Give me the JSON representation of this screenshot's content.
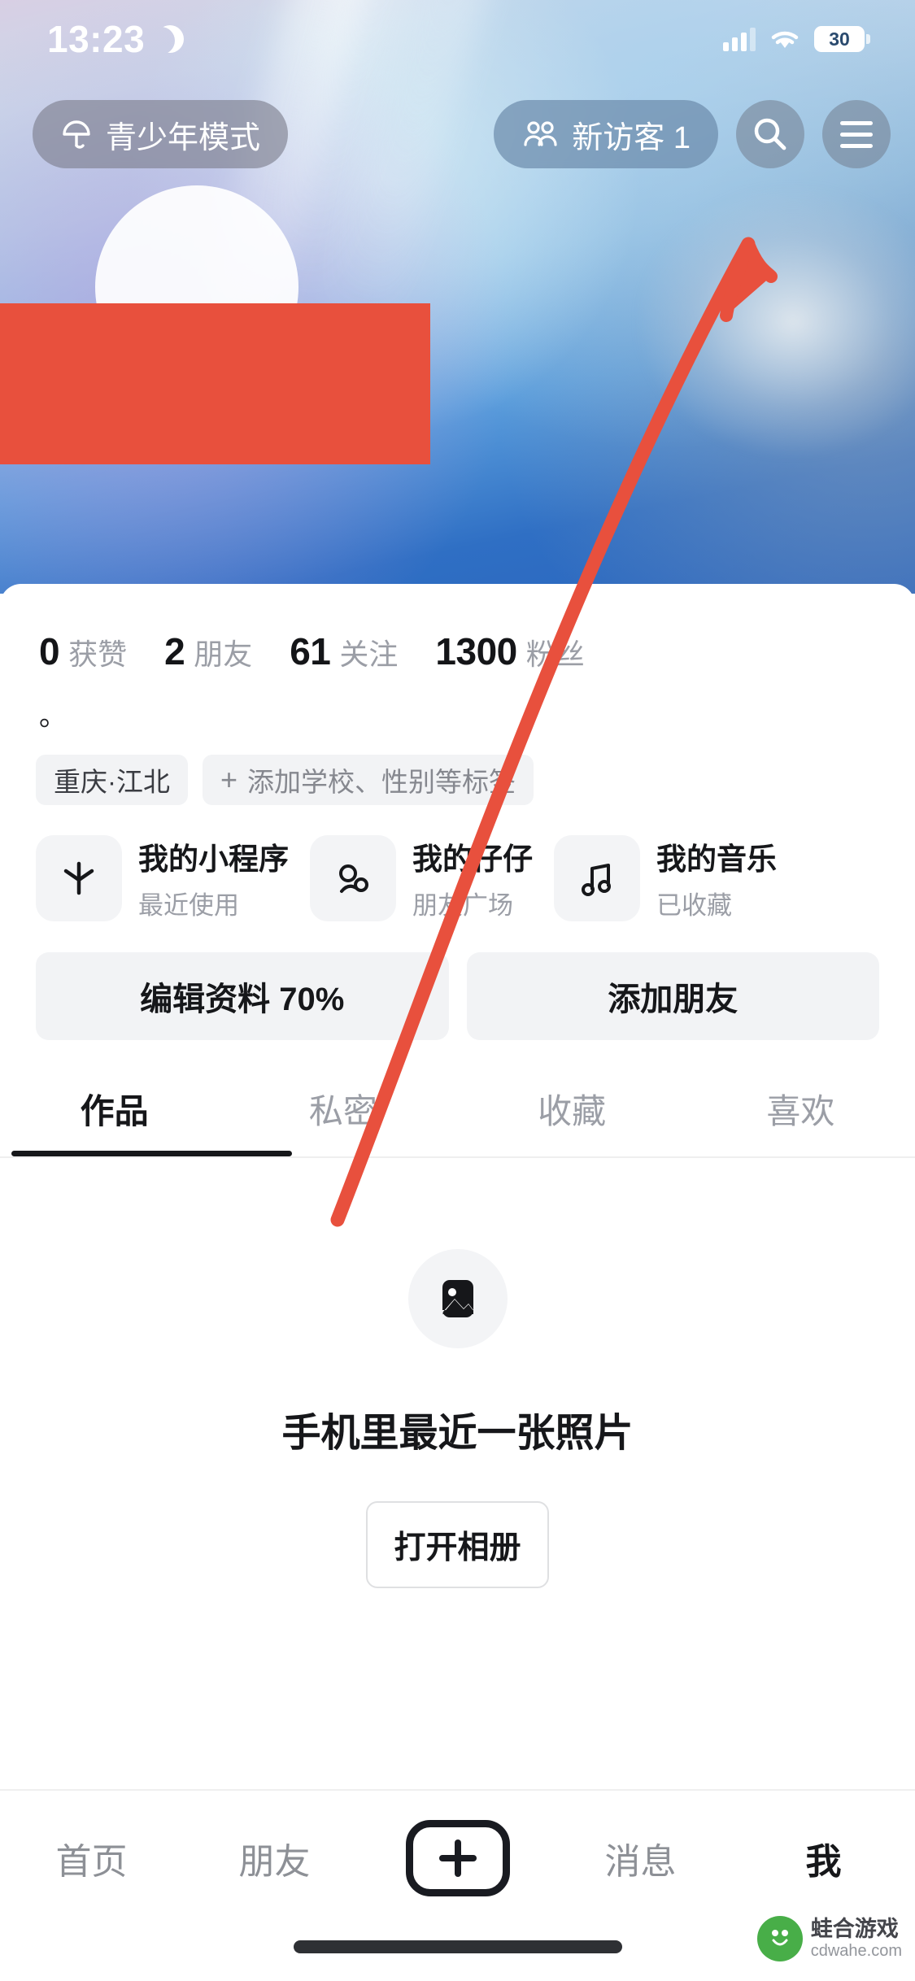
{
  "status_bar": {
    "time": "13:23",
    "moon_icon": "moon-icon",
    "signal_icon": "signal-bars-icon",
    "wifi_icon": "wifi-icon",
    "battery_level": "30"
  },
  "header": {
    "teen_mode_label": "青少年模式",
    "teen_mode_icon": "umbrella-icon",
    "visitor_label": "新访客 1",
    "visitor_icon": "people-icon",
    "search_icon": "search-icon",
    "menu_icon": "hamburger-menu-icon"
  },
  "annotation": {
    "arrow_color": "#e8503d",
    "redaction_color": "#e8503d"
  },
  "profile": {
    "stats": [
      {
        "num": "0",
        "label": "获赞"
      },
      {
        "num": "2",
        "label": "朋友"
      },
      {
        "num": "61",
        "label": "关注"
      },
      {
        "num": "1300",
        "label": "粉丝"
      }
    ],
    "bio": "。",
    "tags": [
      {
        "text": "重庆·江北",
        "type": "location"
      },
      {
        "text": "添加学校、性别等标签",
        "type": "add",
        "plus": "+"
      }
    ],
    "mini_cards": [
      {
        "title": "我的小程序",
        "sub": "最近使用",
        "icon": "asterisk-icon"
      },
      {
        "title": "我的仔仔",
        "sub": "朋友广场",
        "icon": "character-icon"
      },
      {
        "title": "我的音乐",
        "sub": "已收藏",
        "icon": "music-note-icon"
      }
    ],
    "actions": [
      {
        "label": "编辑资料 70%"
      },
      {
        "label": "添加朋友"
      }
    ]
  },
  "tabs": [
    {
      "label": "作品",
      "active": true
    },
    {
      "label": "私密",
      "active": false
    },
    {
      "label": "收藏",
      "active": false
    },
    {
      "label": "喜欢",
      "active": false
    }
  ],
  "empty_state": {
    "icon": "image-placeholder-icon",
    "title": "手机里最近一张照片",
    "button_label": "打开相册"
  },
  "bottom_nav": {
    "items": [
      {
        "label": "首页",
        "active": false
      },
      {
        "label": "朋友",
        "active": false
      },
      {
        "label": "",
        "active": false,
        "icon": "plus-icon"
      },
      {
        "label": "消息",
        "active": false
      },
      {
        "label": "我",
        "active": true
      }
    ]
  },
  "watermark": {
    "name": "蛙合游戏",
    "domain": "cdwahe.com"
  }
}
